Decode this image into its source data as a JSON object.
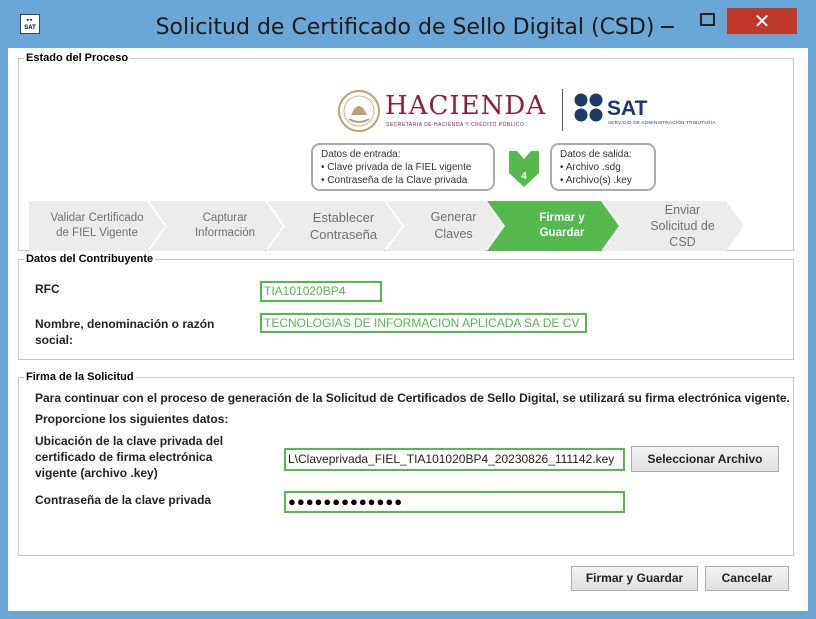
{
  "window": {
    "title": "Solicitud de Certificado de Sello Digital (CSD)",
    "icon_label": "SAT",
    "close_glyph": "✕"
  },
  "proceso": {
    "legend": "Estado del Proceso",
    "logos": {
      "hacienda": "HACIENDA",
      "hacienda_sub": "SECRETARÍA DE HACIENDA Y CRÉDITO PÚBLICO",
      "sat": "SAT",
      "sat_sub": "SERVICIO DE ADMINISTRACIÓN TRIBUTARIA"
    },
    "entrada": {
      "title": "Datos de entrada:",
      "items": [
        "• Clave privada de la FIEL vigente",
        "• Contraseña de la Clave privada"
      ]
    },
    "salida": {
      "title": "Datos de salida:",
      "items": [
        "• Archivo .sdg",
        "• Archivo(s) .key"
      ]
    },
    "current_step": "4",
    "steps": [
      {
        "line1": "Validar Certificado",
        "line2": "de FIEL Vigente",
        "active": false
      },
      {
        "line1": "Capturar",
        "line2": "Información",
        "active": false
      },
      {
        "line1": "Establecer",
        "line2": "Contraseña",
        "active": false
      },
      {
        "line1": "Generar",
        "line2": "Claves",
        "active": false
      },
      {
        "line1": "Firmar y",
        "line2": "Guardar",
        "active": true
      },
      {
        "line1": "Enviar",
        "line2": "Solicitud de",
        "line3": "CSD",
        "active": false
      }
    ]
  },
  "contribuyente": {
    "legend": "Datos del Contribuyente",
    "rfc_label": "RFC",
    "rfc_value": "TIA101020BP4",
    "nombre_label_1": "Nombre, denominación o razón",
    "nombre_label_2": "social:",
    "nombre_value": "TECNOLOGIAS DE INFORMACION APLICADA SA DE CV"
  },
  "firma": {
    "legend": "Firma de la Solicitud",
    "intro": "Para continuar con el proceso de generación de la Solicitud de Certificados de Sello Digital, se utilizará su firma electrónica vigente.",
    "proporcione": "Proporcione los siguientes datos:",
    "ubicacion_label_1": "Ubicación de la clave privada del",
    "ubicacion_label_2": "certificado de firma electrónica",
    "ubicacion_label_3": "vigente (archivo .key)",
    "ubicacion_value": "L\\Claveprivada_FIEL_TIA101020BP4_20230826_111142.key",
    "seleccionar_button": "Seleccionar Archivo",
    "password_label": "Contraseña de la clave privada",
    "password_value": "●●●●●●●●●●●●●"
  },
  "footer": {
    "firmar_button": "Firmar y Guardar",
    "cancelar_button": "Cancelar"
  },
  "colors": {
    "accent_green": "#55b950",
    "title_bar": "#6aa6d6",
    "close_red": "#c0392b",
    "hacienda": "#8e1f3a",
    "sat_blue": "#1a3a6a"
  }
}
